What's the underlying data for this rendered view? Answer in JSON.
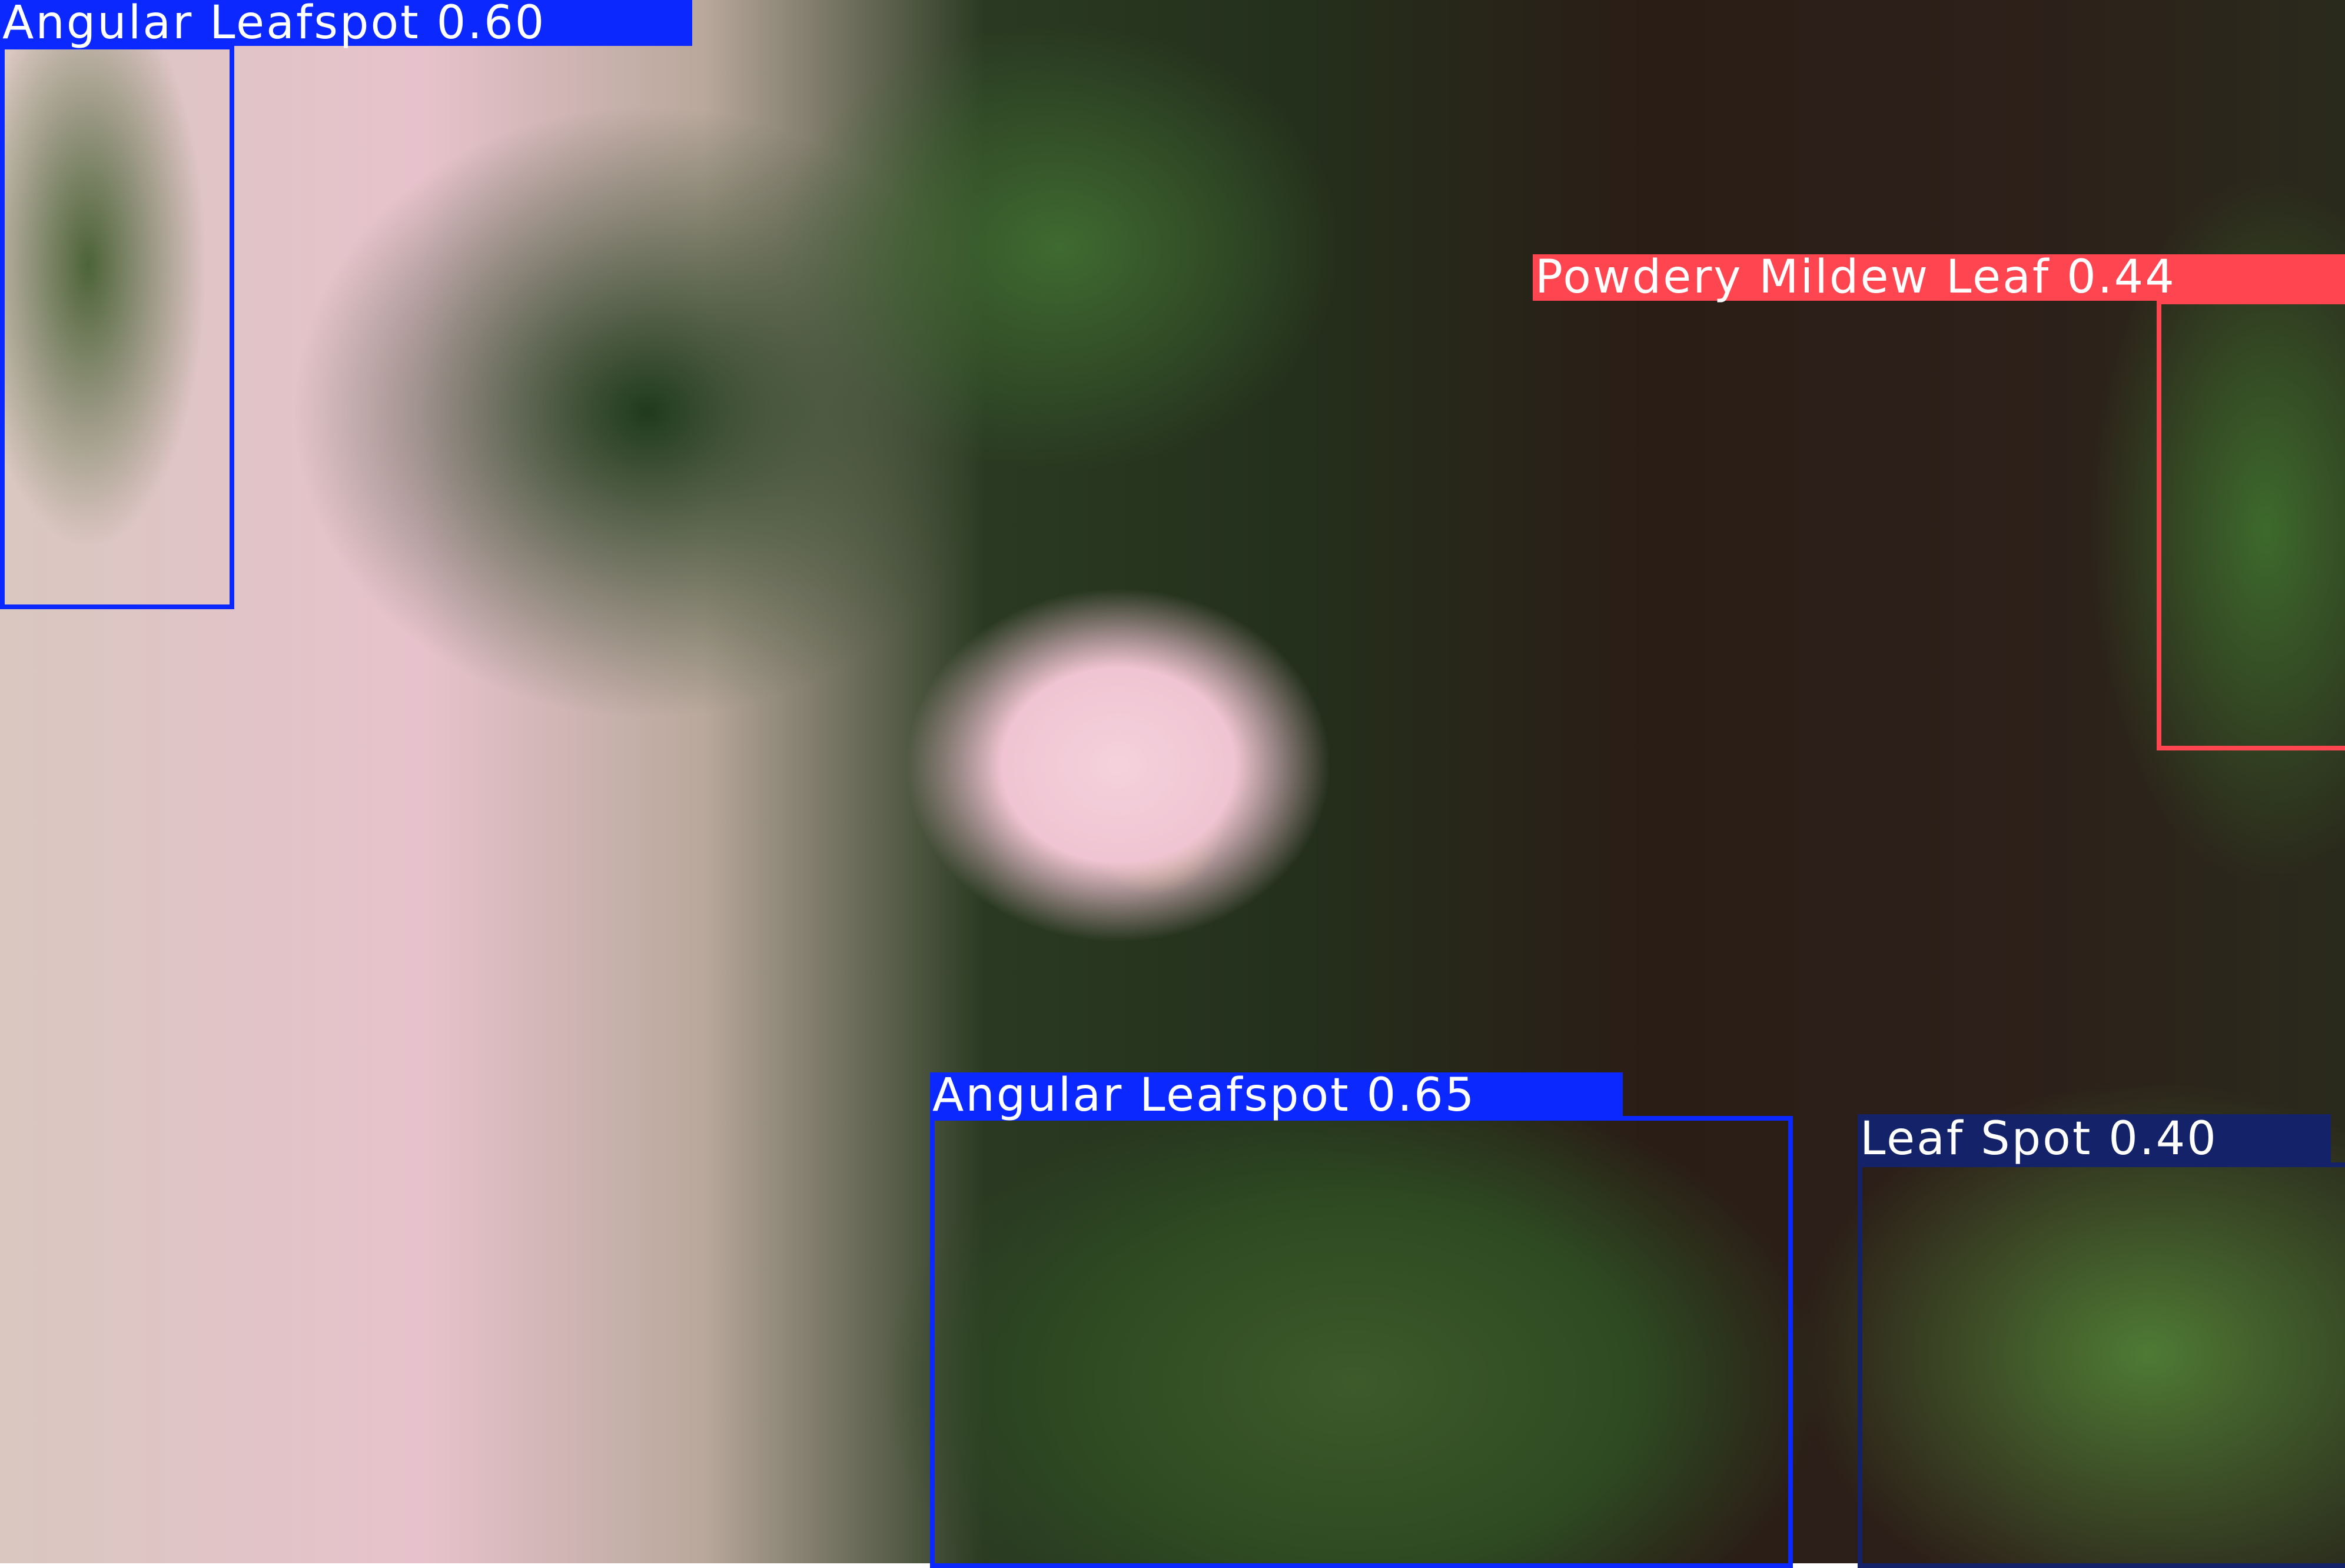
{
  "detections": [
    {
      "label": "Angular Leafspot 0.60",
      "class": "Angular Leafspot",
      "confidence": 0.6,
      "color": "#0a28ff"
    },
    {
      "label": "Powdery Mildew Leaf 0.44",
      "class": "Powdery Mildew Leaf",
      "confidence": 0.44,
      "color": "#ff4650"
    },
    {
      "label": "Angular Leafspot 0.65",
      "class": "Angular Leafspot",
      "confidence": 0.65,
      "color": "#0a28ff"
    },
    {
      "label": "Leaf Spot 0.40",
      "class": "Leaf Spot",
      "confidence": 0.4,
      "color": "#142369"
    }
  ]
}
